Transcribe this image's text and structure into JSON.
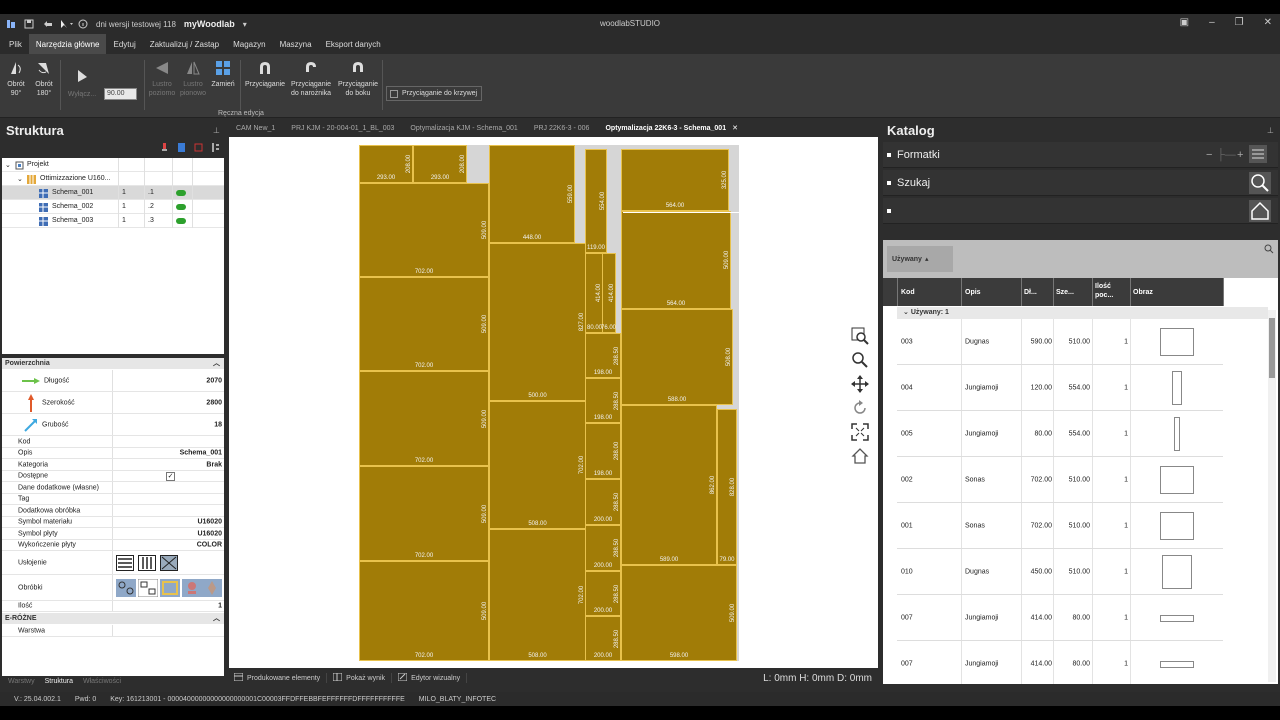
{
  "titlebar": {
    "version_info": "dni wersji testowej 118",
    "app_name": "myWoodlab",
    "window_title": "woodlabSTUDIO"
  },
  "menu": [
    "Plik",
    "Narzędzia główne",
    "Edytuj",
    "Zaktualizuj / Zastąp",
    "Magazyn",
    "Maszyna",
    "Eksport danych"
  ],
  "ribbon": {
    "rotate90": "Obrót\n90°",
    "rotate180": "Obrót\n180°",
    "tilt": "Wyłącz...",
    "angle_value": "90.00",
    "mirror_h": "Lustro\npoziomo",
    "mirror_v": "Lustro\npionowo",
    "swap": "Zamień",
    "snap": "Przyciąganie",
    "snap_corner": "Przyciąganie\ndo narożnika",
    "snap_side": "Przyciąganie\ndo boku",
    "snap_curve": "Przyciąganie do krzywej",
    "group_label": "Ręczna edycja"
  },
  "structure": {
    "title": "Struktura",
    "tree": [
      {
        "label": "Projekt",
        "level": 0
      },
      {
        "label": "Ottimizzazione U160...",
        "level": 1
      },
      {
        "label": "Schema_001",
        "qty": "1",
        "idx": ".1",
        "level": 2,
        "selected": true
      },
      {
        "label": "Schema_002",
        "qty": "1",
        "idx": ".2",
        "level": 2
      },
      {
        "label": "Schema_003",
        "qty": "1",
        "idx": ".3",
        "level": 2
      }
    ]
  },
  "props": {
    "section1": "Powierzchnia",
    "length_label": "Długość",
    "length_value": "2070",
    "width_label": "Szerokość",
    "width_value": "2800",
    "thick_label": "Grubość",
    "thick_value": "18",
    "code_label": "Kod",
    "desc_label": "Opis",
    "desc_value": "Schema_001",
    "cat_label": "Kategoria",
    "cat_value": "Brak",
    "avail_label": "Dostępne",
    "extra_label": "Dane dodatkowe (własne)",
    "tag_label": "Tag",
    "addproc_label": "Dodatkowa obróbka",
    "matsym_label": "Symbol materiału",
    "matsym_value": "U16020",
    "boardsym_label": "Symbol płyty",
    "boardsym_value": "U16020",
    "finish_label": "Wykończenie płyty",
    "finish_value": "COLOR",
    "layout_label": "Usłojenie",
    "proc_label": "Obróbki",
    "qty_label": "Ilość",
    "qty_value": "1",
    "section2": "E-RÓŻNE",
    "layer_label": "Warstwa"
  },
  "left_tabs": [
    "Warstwy",
    "Struktura",
    "Właściwości"
  ],
  "doc_tabs": [
    "CAM New_1",
    "PRJ KJM - 20-004-01_1_BL_003",
    "Optymalizacja KJM - Schema_001",
    "PRJ 22K6-3 - 006",
    "Optymalizacja 22K6-3 - Schema_001"
  ],
  "parts": [
    {
      "label": "293.00",
      "vlabel": "208.00"
    },
    {
      "label": "293.00",
      "vlabel": "208.00"
    },
    {
      "label": "702.00",
      "vlabel": "509.00"
    },
    {
      "label": "702.00",
      "vlabel": "509.00"
    },
    {
      "label": "702.00",
      "vlabel": "509.00"
    },
    {
      "label": "702.00",
      "vlabel": "509.00"
    },
    {
      "label": "702.00",
      "vlabel": "509.00"
    },
    {
      "label": "448.00",
      "vlabel": "559.00"
    },
    {
      "label": "500.00",
      "vlabel": "827.00"
    },
    {
      "label": "508.00",
      "vlabel": "702.00"
    },
    {
      "label": "508.00",
      "vlabel": "702.00"
    },
    {
      "label": "119.00",
      "vlabel": "554.00"
    },
    {
      "label": "",
      "vlabel": "414.00"
    },
    {
      "label": "",
      "vlabel": "414.00"
    },
    {
      "label": "80.00",
      "vlabel": ""
    },
    {
      "label": "76.00",
      "vlabel": ""
    },
    {
      "label": "198.00",
      "vlabel": "288.50"
    },
    {
      "label": "198.00",
      "vlabel": "288.50"
    },
    {
      "label": "198.00",
      "vlabel": "288.00"
    },
    {
      "label": "200.00",
      "vlabel": "288.50"
    },
    {
      "label": "200.00",
      "vlabel": "288.50"
    },
    {
      "label": "200.00",
      "vlabel": "288.50"
    },
    {
      "label": "200.00",
      "vlabel": "288.50"
    },
    {
      "label": "564.00",
      "vlabel": "325.00"
    },
    {
      "label": "564.00",
      "vlabel": "509.00"
    },
    {
      "label": "588.00",
      "vlabel": "508.00"
    },
    {
      "label": "589.00",
      "vlabel": "862.00"
    },
    {
      "label": "79.00",
      "vlabel": "828.00"
    },
    {
      "label": "598.00",
      "vlabel": "509.00"
    }
  ],
  "canvas_status": {
    "produced": "Produkowane elementy",
    "show_result": "Pokaż wynik",
    "visual_editor": "Edytor wizualny",
    "dims": "L: 0mm  H: 0mm  D: 0mm"
  },
  "catalog": {
    "title": "Katalog",
    "formats": "Formatki",
    "search": "Szukaj",
    "used_btn": "Używany",
    "columns": [
      "Kod",
      "Opis",
      "Dł...",
      "Sze...",
      "Ilość poc...",
      "Obraz"
    ],
    "group": "Używany: 1",
    "rows": [
      {
        "kod": "003",
        "opis": "Dugnas",
        "dl": "590.00",
        "sz": "510.00",
        "il": "1",
        "shape": "wide"
      },
      {
        "kod": "004",
        "opis": "Jungiamoji",
        "dl": "120.00",
        "sz": "554.00",
        "il": "1",
        "shape": "tall"
      },
      {
        "kod": "005",
        "opis": "Jungiamoji",
        "dl": "80.00",
        "sz": "554.00",
        "il": "1",
        "shape": "thin"
      },
      {
        "kod": "002",
        "opis": "Sonas",
        "dl": "702.00",
        "sz": "510.00",
        "il": "1",
        "shape": "wide"
      },
      {
        "kod": "001",
        "opis": "Sonas",
        "dl": "702.00",
        "sz": "510.00",
        "il": "1",
        "shape": "wide"
      },
      {
        "kod": "010",
        "opis": "Dugnas",
        "dl": "450.00",
        "sz": "510.00",
        "il": "1",
        "shape": "square"
      },
      {
        "kod": "007",
        "opis": "Jungiamoji",
        "dl": "414.00",
        "sz": "80.00",
        "il": "1",
        "shape": "flat"
      },
      {
        "kod": "007",
        "opis": "Jungiamoji",
        "dl": "414.00",
        "sz": "80.00",
        "il": "1",
        "shape": "flat"
      }
    ]
  },
  "status": {
    "version": "V.: 25.04.002.1",
    "pwd": "Pwd: 0",
    "key": "Key: 161213001 - 00004000000000000000001C00003FFDFFEBBFEFFFFFFDFFFFFFFFFFE",
    "license": "MILO_BLATY_INFOTEC"
  },
  "colors": {
    "part_fill": "#a17c07",
    "part_border": "#e8c24d",
    "accent_active_tab": "#4a4a4a"
  }
}
